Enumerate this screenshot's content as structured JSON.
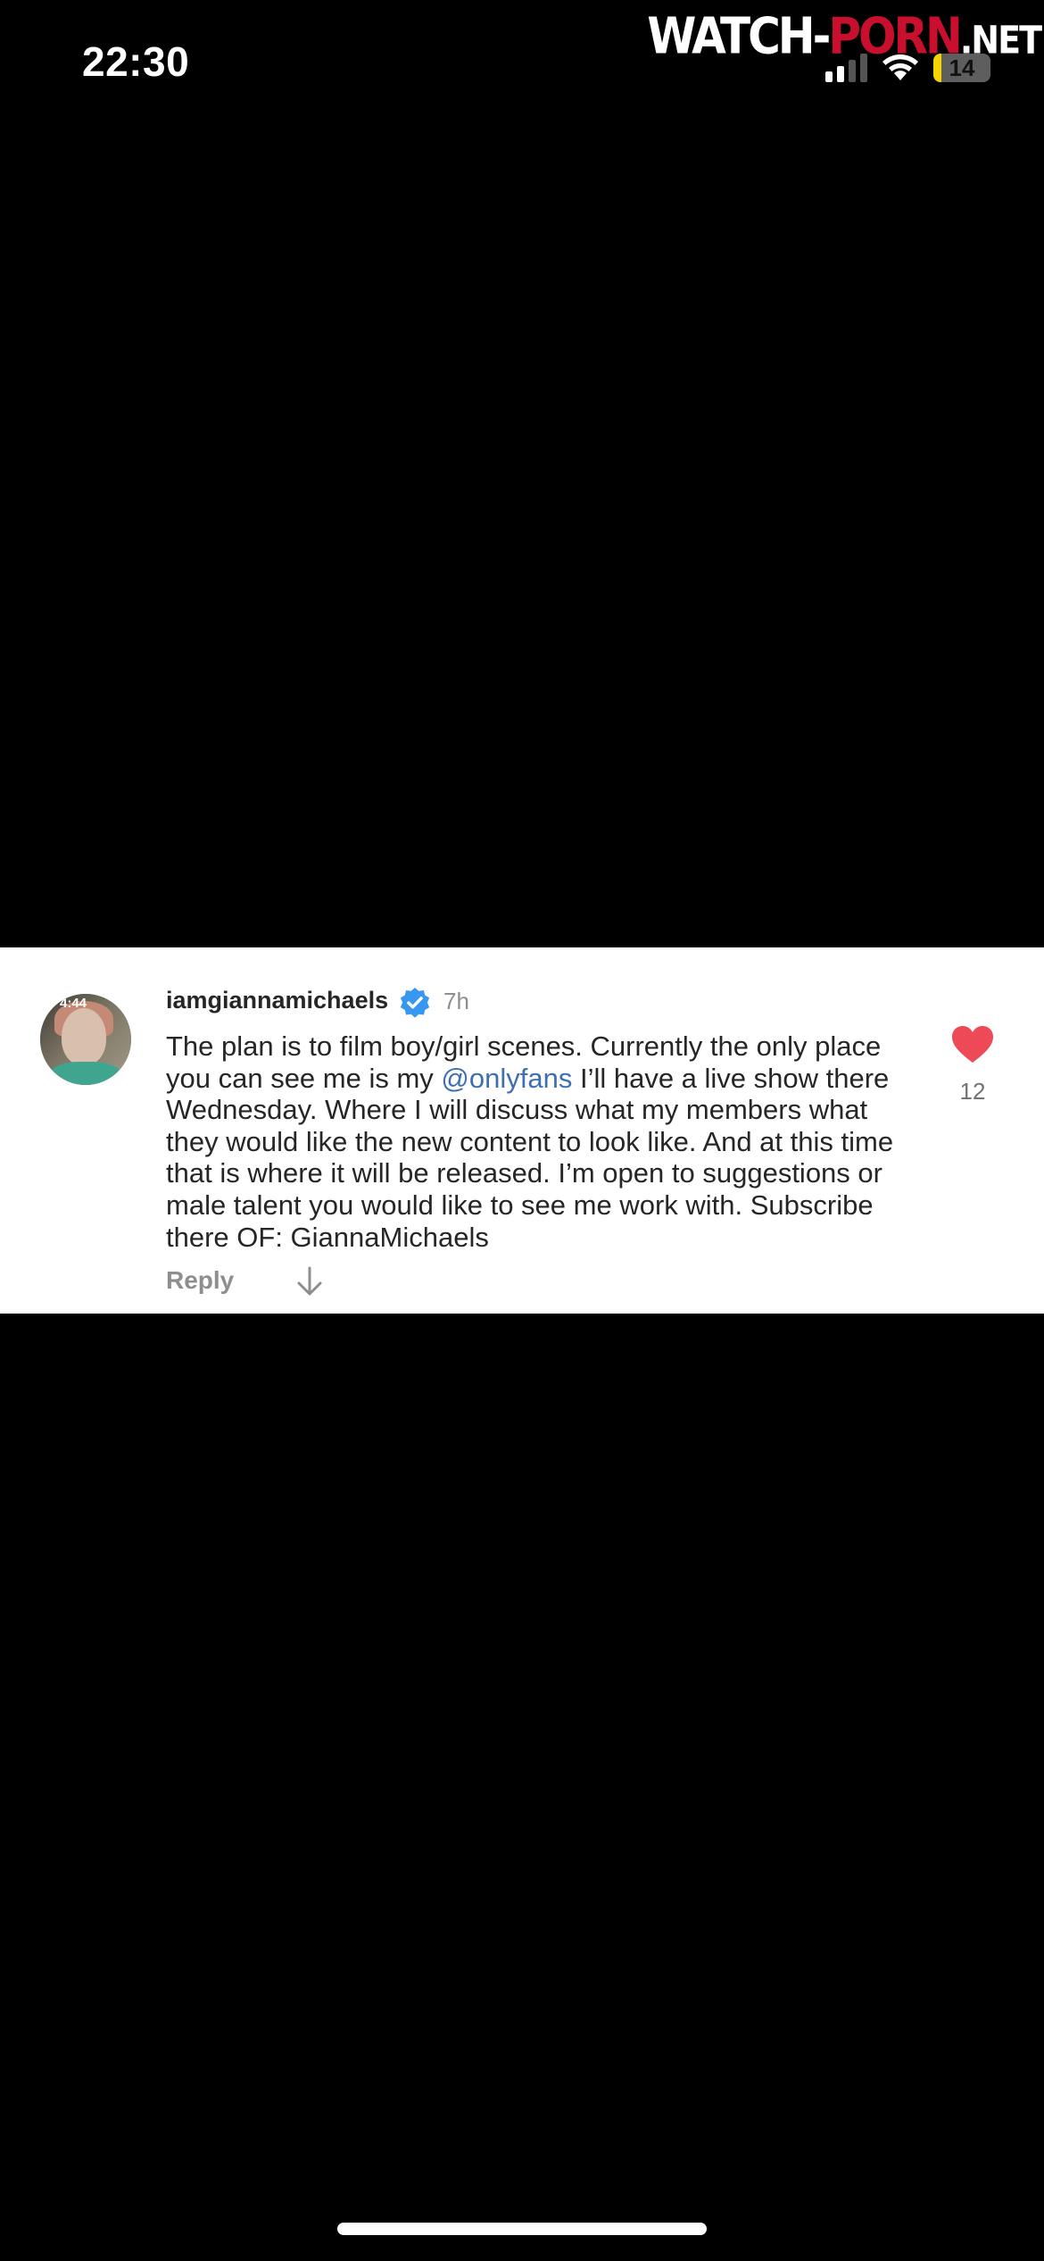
{
  "status_bar": {
    "time": "22:30",
    "battery_level": "14",
    "battery_fraction": 0.14
  },
  "watermark": {
    "part1": "WATCH-",
    "part2": "PORN",
    "part3": ".NET"
  },
  "comment": {
    "avatar_time": "4:44",
    "username": "iamgiannamichaels",
    "verified": true,
    "time_ago": "7h",
    "text_before_mention": "The plan is to film boy/girl scenes. Currently the only place you can see me is my ",
    "mention": "@onlyfans",
    "text_after_mention": " I’ll have a live show there Wednesday. Where I will discuss what my members what they would like the new content to look like. And at this time that is where it will be released. I’m open to suggestions or male talent you would like to see me work with. Subscribe there OF: GiannaMichaels",
    "reply_label": "Reply",
    "like_count": "12"
  },
  "colors": {
    "background": "#000000",
    "card": "#ffffff",
    "verified_blue": "#3897f0",
    "heart_red": "#ed4956",
    "mention_blue": "#3f6fb3"
  },
  "icons": [
    "signal-icon",
    "wifi-icon",
    "battery-icon",
    "verified-badge-icon",
    "heart-icon",
    "down-arrow-icon"
  ]
}
